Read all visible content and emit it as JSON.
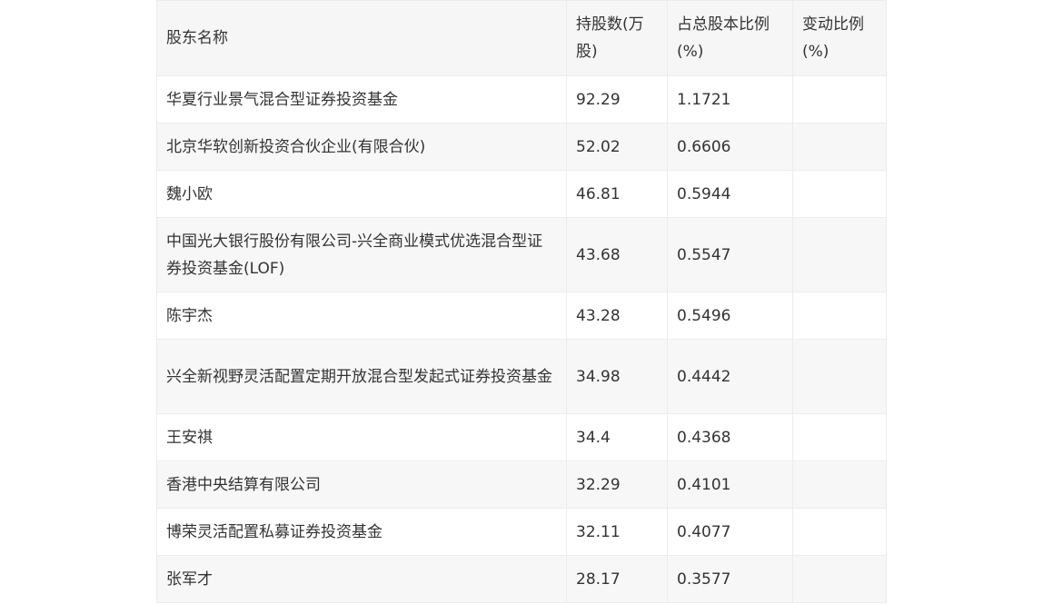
{
  "table": {
    "headers": [
      "股东名称",
      "持股数(万股)",
      "占总股本比例(%)",
      "变动比例(%)"
    ],
    "rows": [
      [
        "华夏行业景气混合型证券投资基金",
        "92.29",
        "1.1721",
        ""
      ],
      [
        "北京华软创新投资合伙企业(有限合伙)",
        "52.02",
        "0.6606",
        ""
      ],
      [
        "魏小欧",
        "46.81",
        "0.5944",
        ""
      ],
      [
        "中国光大银行股份有限公司-兴全商业模式优选混合型证券投资基金(LOF)",
        "43.68",
        "0.5547",
        ""
      ],
      [
        "陈宇杰",
        "43.28",
        "0.5496",
        ""
      ],
      [
        "兴全新视野灵活配置定期开放混合型发起式证券投资基金",
        "34.98",
        "0.4442",
        ""
      ],
      [
        "王安祺",
        "34.4",
        "0.4368",
        ""
      ],
      [
        "香港中央结算有限公司",
        "32.29",
        "0.4101",
        ""
      ],
      [
        "博荣灵活配置私募证券投资基金",
        "32.11",
        "0.4077",
        ""
      ],
      [
        "张军才",
        "28.17",
        "0.3577",
        ""
      ]
    ]
  }
}
